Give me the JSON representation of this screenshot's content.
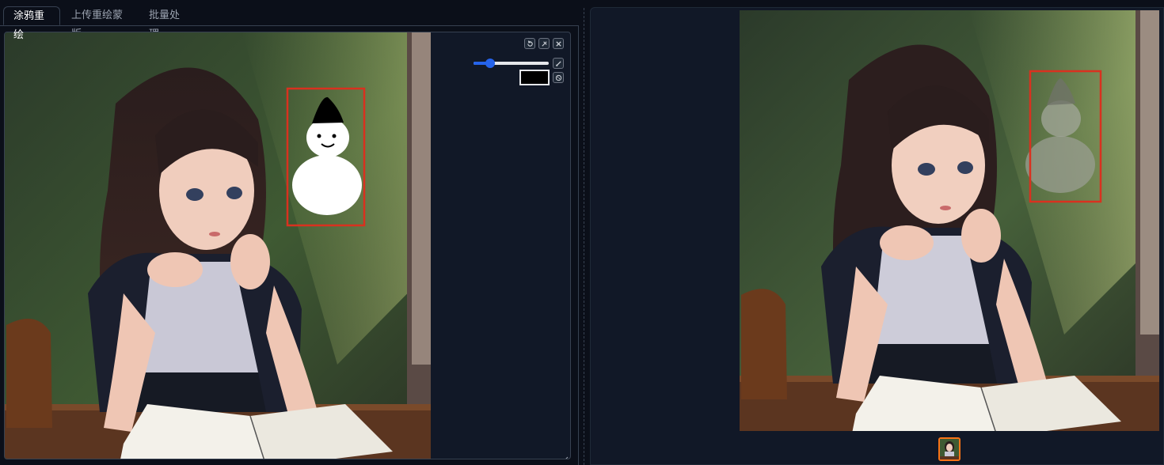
{
  "tabs": [
    {
      "label": "涂鸦重绘",
      "active": true
    },
    {
      "label": "上传重绘蒙版",
      "active": false
    },
    {
      "label": "批量处理",
      "active": false
    }
  ],
  "editor": {
    "tools": [
      "undo-icon",
      "clear-icon",
      "close-icon"
    ],
    "brush_size": 0.22,
    "brush_color": "#000000",
    "colors": {
      "accent": "#2563eb",
      "mask_box": "#d9311f",
      "selected_thumb": "#f97316"
    }
  },
  "gallery": {
    "thumbnails": [
      {
        "selected": true
      }
    ]
  }
}
